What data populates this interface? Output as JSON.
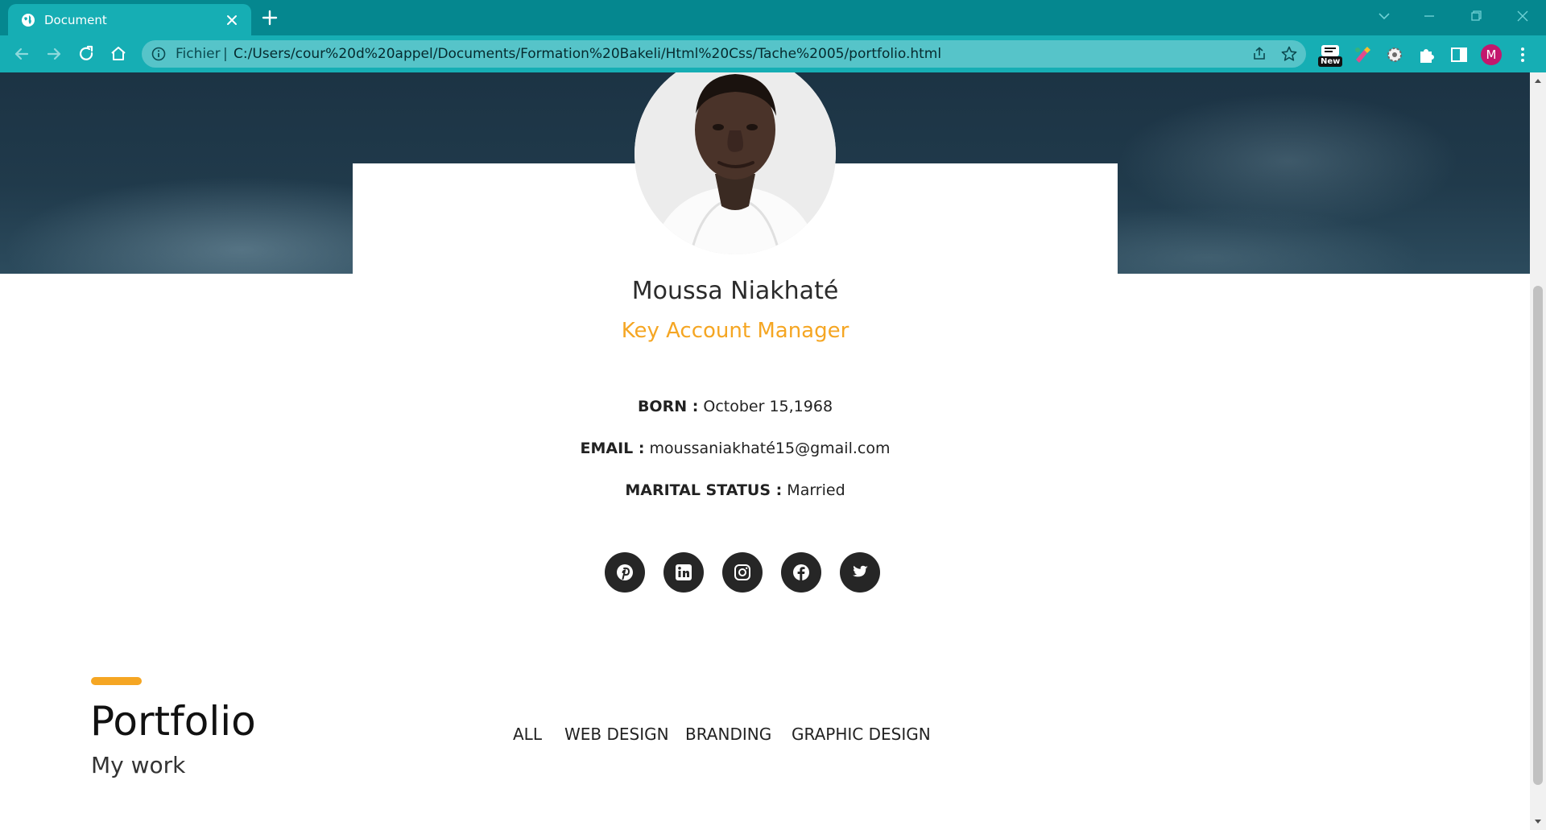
{
  "browser": {
    "tab_title": "Document",
    "scheme_label": "Fichier",
    "url_separator": "|",
    "url": "C:/Users/cour%20d%20appel/Documents/Formation%20Bakeli/Html%20Css/Tache%2005/portfolio.html",
    "extension_badge": "New",
    "profile_initial": "M"
  },
  "profile": {
    "name": "Moussa Niakhaté",
    "role": "Key Account Manager",
    "details": [
      {
        "label": "BORN :",
        "value": "October 15,1968"
      },
      {
        "label": "EMAIL :",
        "value": "moussaniakhaté15@gmail.com"
      },
      {
        "label": "MARITAL STATUS :",
        "value": "Married"
      }
    ],
    "socials": [
      "pinterest-icon",
      "linkedin-icon",
      "instagram-icon",
      "facebook-icon",
      "twitter-icon"
    ]
  },
  "portfolio": {
    "title": "Portfolio",
    "subtitle": "My work",
    "filters": [
      "ALL",
      "WEB DESIGN",
      "BRANDING",
      "GRAPHIC DESIGN"
    ]
  },
  "colors": {
    "accent": "#f5a623",
    "tabbar": "#05878f",
    "toolbar": "#16aeb4",
    "social_bg": "#262626"
  }
}
